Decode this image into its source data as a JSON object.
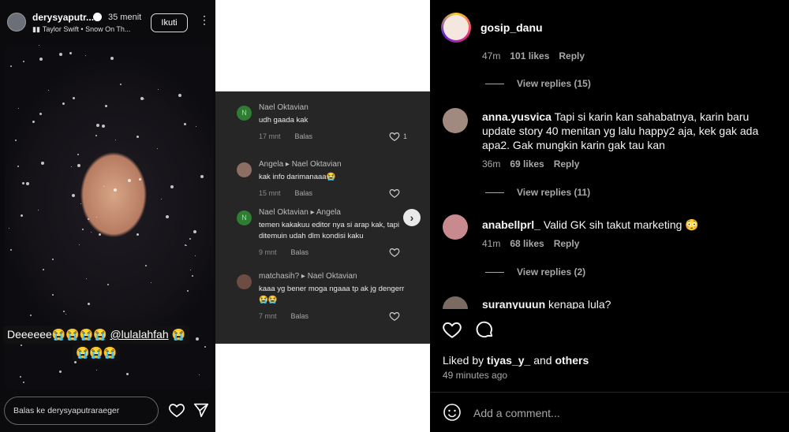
{
  "story": {
    "username": "derysyaputr...",
    "time": "35 menit",
    "music": "Taylor Swift • Snow On Th...",
    "follow_label": "Ikuti",
    "caption_line1_text": "Deeeeee😭😭😭😭",
    "caption_mention": "@lulalahfah",
    "caption_line1_end": "😭",
    "caption_line2": "😭😭😭",
    "reply_placeholder": "Balas ke derysyaputraraeger"
  },
  "screenshot_comments": [
    {
      "name": "Nael Oktavian",
      "text": [
        "udh gaada kak"
      ],
      "time": "17 mnt",
      "reply": "Balas",
      "likes": "1",
      "avatar_color": "#2e7d32",
      "avatar_letter": "N"
    },
    {
      "name": "Angela ▸ Nael Oktavian",
      "text": [
        "kak info darimanaaa😭"
      ],
      "time": "15 mnt",
      "reply": "Balas",
      "likes": "",
      "avatar_color": "#8d6e63",
      "avatar_letter": ""
    },
    {
      "name": "Nael Oktavian ▸ Angela",
      "text": [
        "temen kakakuu editor nya si arap kak, tapi",
        "ditemuin udah dlm kondisi kaku"
      ],
      "time": "9 mnt",
      "reply": "Balas",
      "likes": "",
      "avatar_color": "#2e7d32",
      "avatar_letter": "N"
    },
    {
      "name": "matchasih? ▸ Nael Oktavian",
      "text": [
        "kaaa yg bener moga ngaaa tp ak jg dengerr",
        "😭😭"
      ],
      "time": "7 mnt",
      "reply": "Balas",
      "likes": "",
      "avatar_color": "#6d4c41",
      "avatar_letter": ""
    }
  ],
  "post": {
    "top_user": "gosip_danu",
    "top_meta": {
      "time": "47m",
      "likes": "101 likes",
      "reply": "Reply"
    },
    "top_view_replies": "View replies (15)",
    "comments": [
      {
        "user": "anna.yusvica",
        "text": "Tapi si karin kan sahabatnya, karin baru update story 40 menitan yg lalu happy2 aja, kek gak ada apa2. Gak mungkin karin gak tau kan",
        "time": "36m",
        "likes": "69 likes",
        "reply": "Reply",
        "view_replies": "View replies (11)"
      },
      {
        "user": "anabellprl_",
        "text": "Valid GK sih takut marketing 😳",
        "time": "41m",
        "likes": "68 likes",
        "reply": "Reply",
        "view_replies": "View replies (2)"
      },
      {
        "user": "suranyuuun",
        "text": "kenapa lula?"
      }
    ],
    "liked_by_prefix": "Liked by",
    "liked_by_user": "tiyas_y_",
    "liked_by_and": "and",
    "liked_by_others": "others",
    "time_ago": "49 minutes ago",
    "add_comment_placeholder": "Add a comment..."
  },
  "colors": {
    "accent_green": "#2e7d32",
    "panel_gray": "#262626",
    "meta_gray": "#a8a8a8"
  }
}
